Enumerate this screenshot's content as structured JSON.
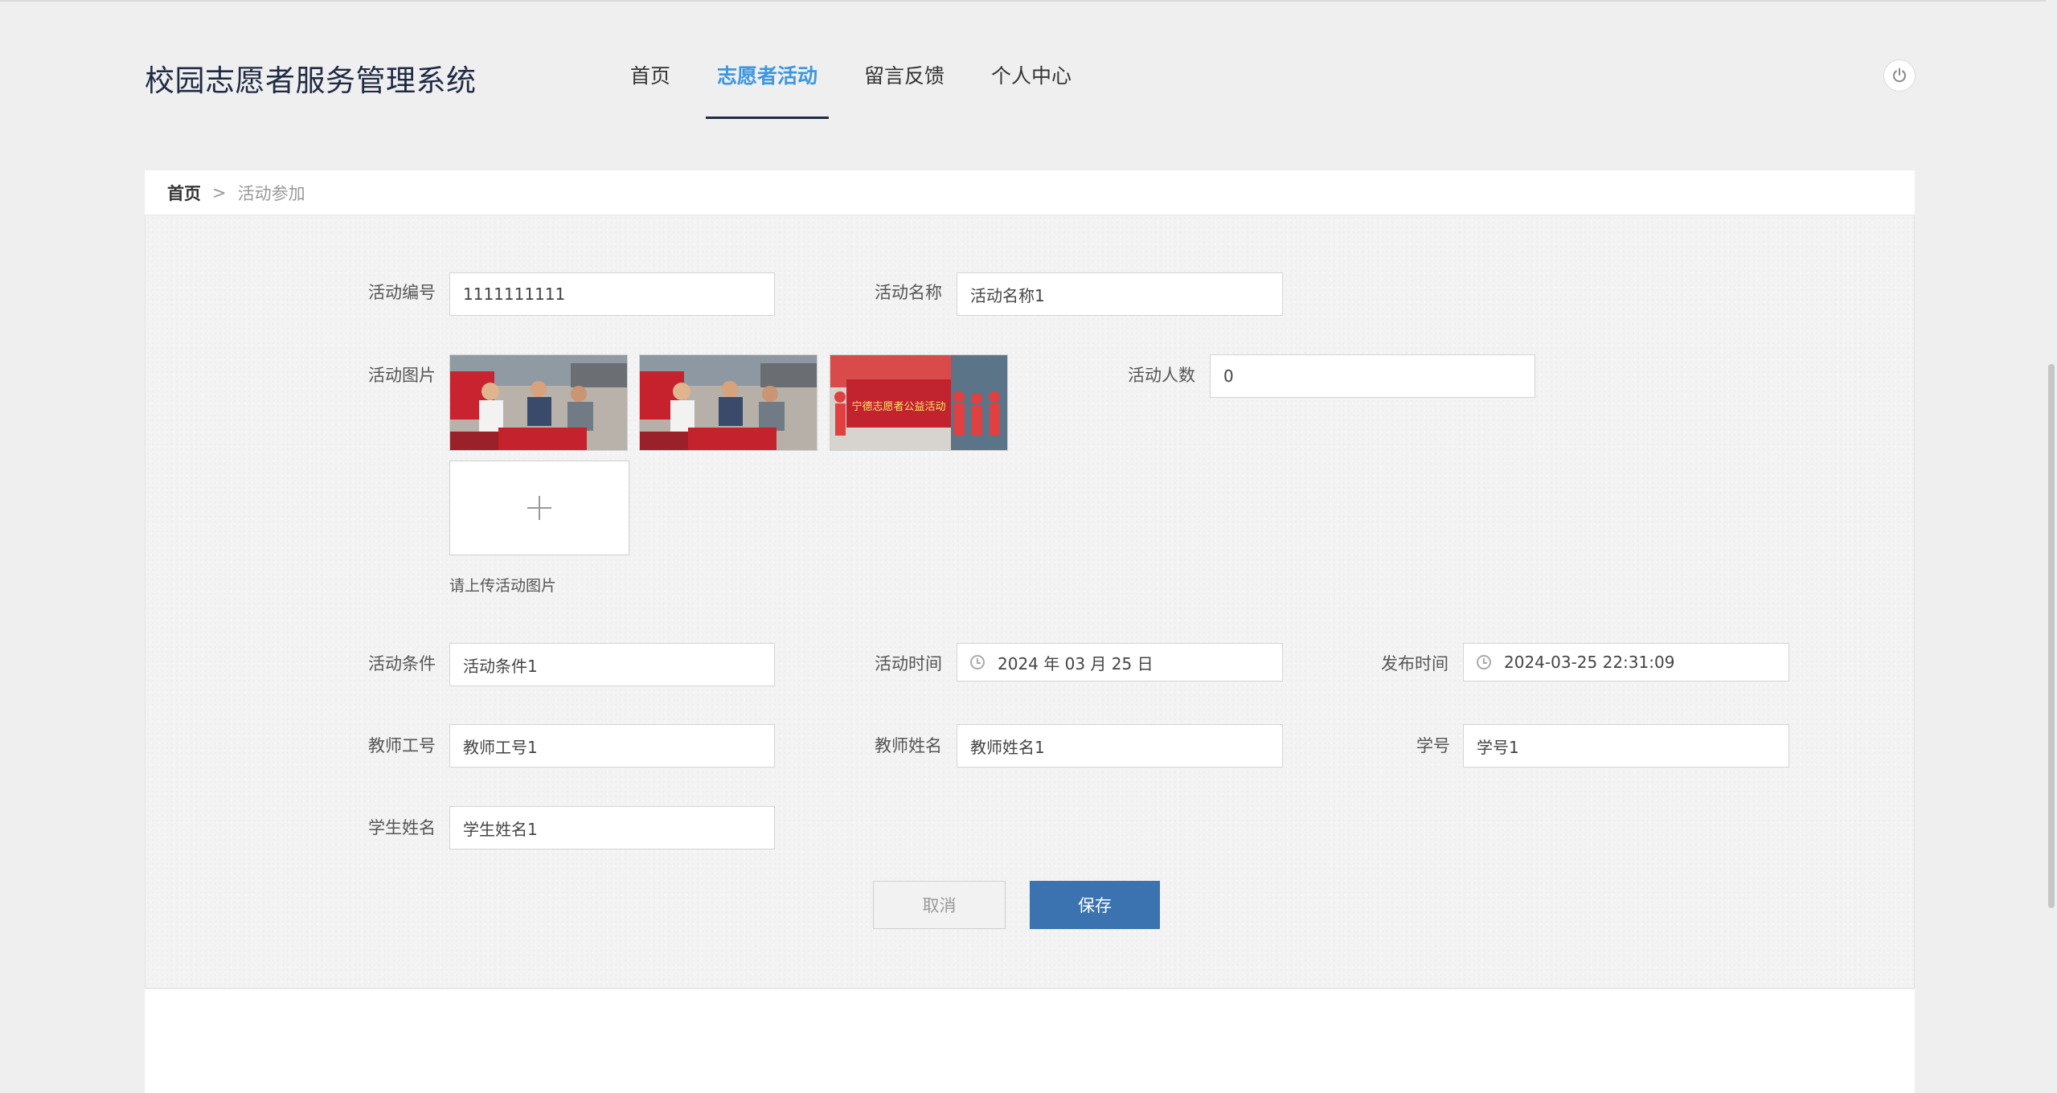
{
  "header": {
    "title": "校园志愿者服务管理系统",
    "nav": [
      {
        "label": "首页",
        "active": false
      },
      {
        "label": "志愿者活动",
        "active": true
      },
      {
        "label": "留言反馈",
        "active": false
      },
      {
        "label": "个人中心",
        "active": false
      }
    ],
    "power_icon": "power-icon",
    "accent_color": "#3c96e0"
  },
  "breadcrumb": {
    "home": "首页",
    "separator": ">",
    "current": "活动参加"
  },
  "form": {
    "activity_no": {
      "label": "活动编号",
      "value": "1111111111"
    },
    "activity_name": {
      "label": "活动名称",
      "value": "活动名称1"
    },
    "activity_images": {
      "label": "活动图片",
      "upload_tip": "请上传活动图片",
      "image_count": 3
    },
    "participant_count": {
      "label": "活动人数",
      "value": "0"
    },
    "activity_condition": {
      "label": "活动条件",
      "value": "活动条件1"
    },
    "activity_time": {
      "label": "活动时间",
      "value": "2024 年 03 月 25 日"
    },
    "publish_time": {
      "label": "发布时间",
      "value": "2024-03-25 22:31:09"
    },
    "teacher_no": {
      "label": "教师工号",
      "value": "教师工号1"
    },
    "teacher_name": {
      "label": "教师姓名",
      "value": "教师姓名1"
    },
    "student_no": {
      "label": "学号",
      "value": "学号1"
    },
    "student_name": {
      "label": "学生姓名",
      "value": "学生姓名1"
    }
  },
  "banner_text": "宁德志愿者公益活动",
  "actions": {
    "cancel_label": "取消",
    "save_label": "保存",
    "save_color": "#3a73b0"
  }
}
